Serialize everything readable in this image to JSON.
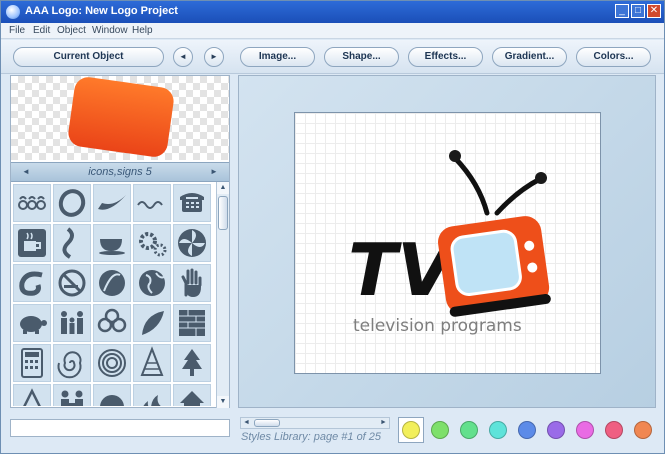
{
  "window": {
    "title": "AAA Logo: New Logo Project",
    "controls": {
      "minimize": "_",
      "maximize": "□",
      "close": "✕"
    }
  },
  "menu": [
    "File",
    "Edit",
    "Object",
    "Window",
    "Help"
  ],
  "toolbar": {
    "current_object": "Current Object",
    "prev_arrow": "◄",
    "next_arrow": "►",
    "image": "Image...",
    "shape": "Shape...",
    "effects": "Effects...",
    "gradient": "Gradient...",
    "colors": "Colors..."
  },
  "library": {
    "title": "icons,signs 5",
    "prev_arrow": "◄",
    "next_arrow": "►",
    "scroll_up": "▲",
    "scroll_down": "▼",
    "icons": [
      "swirls-icon",
      "ring-icon",
      "swoosh-icon",
      "wave-icon",
      "telephone-icon",
      "coffee-cup-icon",
      "s-curve-icon",
      "cup-icon",
      "gears-icon",
      "pinwheel-icon",
      "spiral-hook-icon",
      "no-smoking-icon",
      "leaf-circle-icon",
      "globe-icon",
      "hand-icon",
      "turtle-icon",
      "family-icon",
      "clover-icon",
      "feather-icon",
      "brick-wall-icon",
      "calculator-icon",
      "spiral-icon",
      "concentric-circles-icon",
      "christmas-tree-icon",
      "fir-tree-icon",
      "warning-triangle-icon",
      "handshake-icon",
      "swirl-ball-icon",
      "flames-icon",
      "house-icon"
    ]
  },
  "canvas": {
    "logo_text": "TV",
    "tagline": "television programs",
    "colors": {
      "orange": "#ee4f1a",
      "black": "#111111",
      "screen": "#bfe3f6"
    }
  },
  "name_field": {
    "value": ""
  },
  "styles_library": {
    "status": "Styles Library: page #1 of 25",
    "scroll_left": "◄",
    "scroll_right": "►"
  },
  "swatches": [
    "#f2ef5a",
    "#7ee06b",
    "#63e08d",
    "#5ee3da",
    "#5c8be8",
    "#9a6be8",
    "#e96be4",
    "#ef5f82",
    "#f08752"
  ],
  "selected_swatch": "#f2ef5a"
}
